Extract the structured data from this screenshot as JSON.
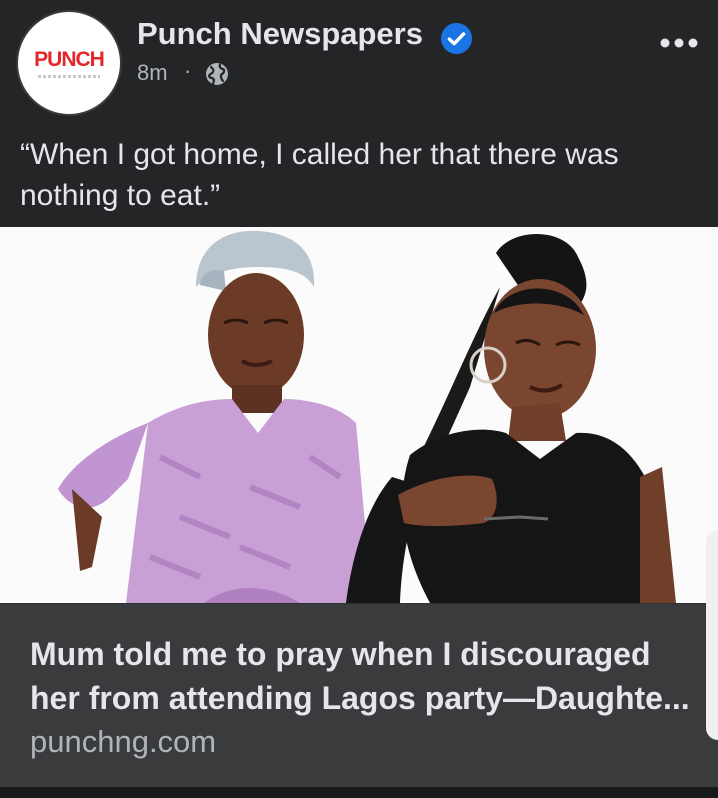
{
  "post": {
    "page_name": "Punch Newspapers",
    "avatar_logo": "PUNCH",
    "time": "8m",
    "separator": "·",
    "audience_icon": "globe-icon",
    "verified_icon": "verified-badge-icon",
    "more_icon": "more-options-icon",
    "text": "“When I got home, I called her that there was nothing to eat.”"
  },
  "link_card": {
    "title": "Mum told me to pray when I discouraged her from attending Lagos party—Daughte...",
    "domain": "punchng.com"
  },
  "colors": {
    "background": "#242526",
    "card": "#3a3b3c",
    "primary_text": "#e4e6eb",
    "secondary_text": "#b0b3b8",
    "verified_blue": "#1b74e4",
    "brand_red": "#e4262b"
  }
}
